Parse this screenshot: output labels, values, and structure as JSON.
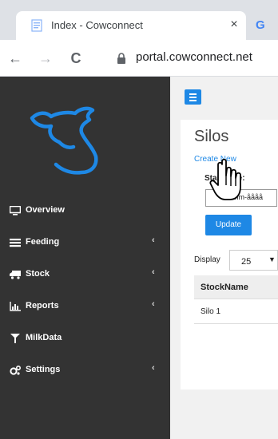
{
  "browser": {
    "tab_title": "Index - Cowconnect",
    "tab_close": "×",
    "second_tab_icon": "G",
    "url": "portal.cowconnect.net",
    "back_icon": "←",
    "forward_icon": "→",
    "reload_icon": "C"
  },
  "sidebar": {
    "logo": "cow-head-logo",
    "brand_color": "#1e88e5",
    "items": [
      {
        "label": "Overview",
        "icon": "monitor-icon",
        "has_submenu": false
      },
      {
        "label": "Feeding",
        "icon": "list-icon",
        "has_submenu": true
      },
      {
        "label": "Stock",
        "icon": "truck-icon",
        "has_submenu": true
      },
      {
        "label": "Reports",
        "icon": "bar-chart-icon",
        "has_submenu": true
      },
      {
        "label": "MilkData",
        "icon": "funnel-icon",
        "has_submenu": false
      },
      {
        "label": "Settings",
        "icon": "gears-icon",
        "has_submenu": true
      }
    ],
    "chevron": "‹"
  },
  "main": {
    "page_title": "Silos",
    "create_link": "Create New",
    "start_date_label": "Start Date:",
    "date_value": "dd-mm-åååå",
    "update_button": "Update",
    "display_label": "Display",
    "display_value": "25",
    "display_arrow": "▼",
    "table": {
      "columns": [
        "StockName"
      ],
      "rows": [
        [
          "Silo 1"
        ]
      ]
    }
  }
}
